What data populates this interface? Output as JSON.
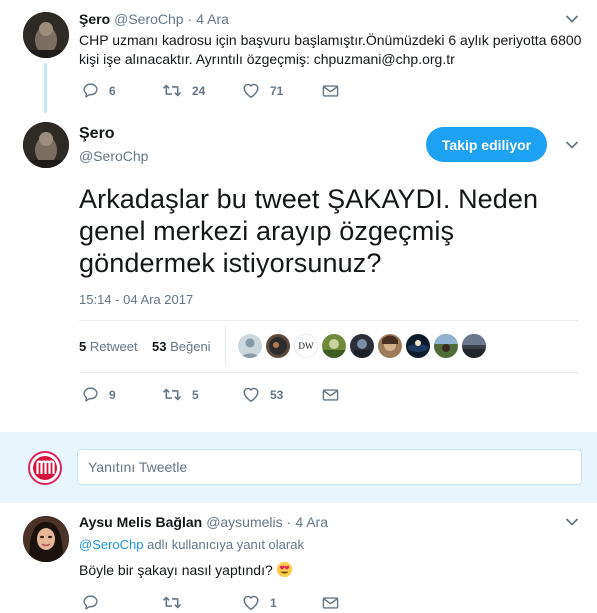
{
  "tweet1": {
    "name": "Şero",
    "handle": "@SeroChp",
    "separator": "·",
    "time": "4 Ara",
    "text_line1": "CHP uzmanı kadrosu için başvuru başlamıştır.Önümüzdeki 6 aylık periyotta 6800",
    "text_line2": "kişi işe alınacaktır. Ayrıntılı özgeçmiş: chpuzmani@chp.org.tr",
    "reply_count": "6",
    "retweet_count": "24",
    "like_count": "71"
  },
  "main_tweet": {
    "name": "Şero",
    "handle": "@SeroChp",
    "follow_label": "Takip ediliyor",
    "text": "Arkadaşlar bu tweet ŞAKAYDI. Neden genel merkezi arayıp özgeçmiş göndermek istiyorsunuz?",
    "timestamp": "15:14 - 04 Ara 2017",
    "stats": {
      "retweets_value": "5",
      "retweets_label": "Retweet",
      "likes_value": "53",
      "likes_label": "Beğeni"
    },
    "liker_avatar_text": "DW",
    "reply_count": "9",
    "retweet_count": "5",
    "like_count": "53"
  },
  "reply_box": {
    "placeholder": "Yanıtını Tweetle"
  },
  "reply": {
    "name": "Aysu Melis Bağlan",
    "handle": "@aysumelis",
    "separator": "·",
    "time": "4 Ara",
    "reply_to_handle": "@SeroChp",
    "reply_to_suffix": "adlı kullanıcıya yanıt olarak",
    "text": "Böyle bir şakayı nasıl yaptındı?",
    "emoji": "😍",
    "like_count": "1"
  },
  "colors": {
    "accent": "#1da1f2",
    "link": "#1b95e0",
    "muted": "#657786",
    "thread_line": "#c4e6f9",
    "reply_bar": "#e8f5fd"
  },
  "icons": [
    "reply-icon",
    "retweet-icon",
    "heart-icon",
    "envelope-icon",
    "chevron-down-icon"
  ]
}
